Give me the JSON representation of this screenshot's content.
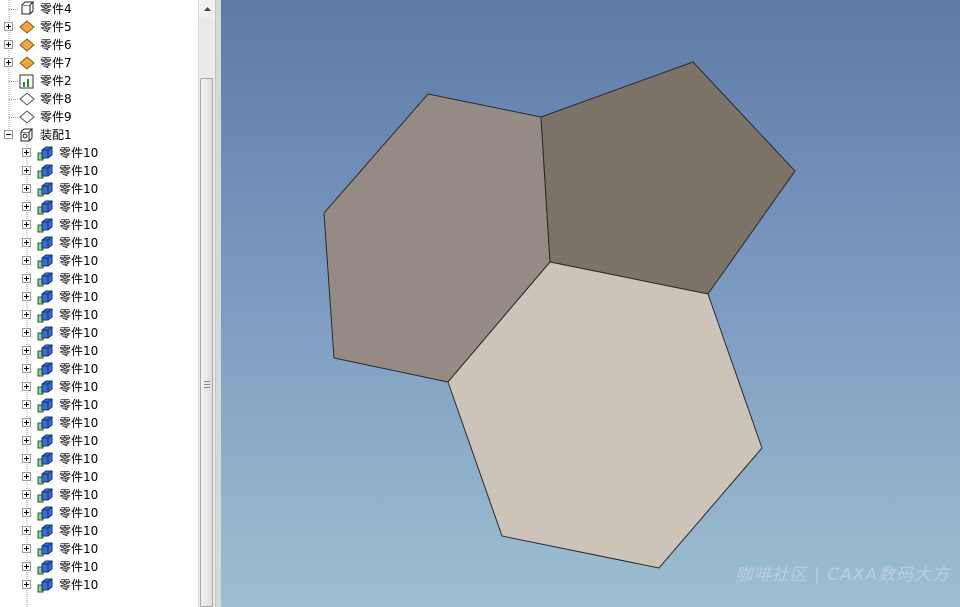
{
  "tree": {
    "top_items": [
      {
        "label": "零件4",
        "icon": "part-outline-icon",
        "expandable": false
      },
      {
        "label": "零件5",
        "icon": "part-diamond-icon",
        "expandable": true
      },
      {
        "label": "零件6",
        "icon": "part-diamond-icon",
        "expandable": true
      },
      {
        "label": "零件7",
        "icon": "part-diamond-icon",
        "expandable": true
      },
      {
        "label": "零件2",
        "icon": "part-chart-icon",
        "expandable": false
      },
      {
        "label": "零件8",
        "icon": "part-diamond-outline-icon",
        "expandable": false
      },
      {
        "label": "零件9",
        "icon": "part-diamond-outline-icon",
        "expandable": false
      },
      {
        "label": "装配1",
        "icon": "assembly-icon",
        "expandable": true,
        "expanded": true
      }
    ],
    "child_label": "零件10",
    "child_icon": "component-cube-icon",
    "children": [
      "零件10",
      "零件10",
      "零件10",
      "零件10",
      "零件10",
      "零件10",
      "零件10",
      "零件10",
      "零件10",
      "零件10",
      "零件10",
      "零件10",
      "零件10",
      "零件10",
      "零件10",
      "零件10",
      "零件10",
      "零件10",
      "零件10",
      "零件10",
      "零件10",
      "零件10",
      "零件10",
      "零件10",
      "零件10"
    ]
  },
  "viewport": {
    "background_top": "#5d7aa8",
    "background_bottom": "#9dbfd0",
    "shapes": [
      {
        "name": "hexagon-left",
        "color": "#958b84"
      },
      {
        "name": "pentagon-right",
        "color": "#7b7268"
      },
      {
        "name": "hexagon-bottom",
        "color": "#cdc4b9"
      }
    ]
  },
  "watermark": "咖啡社区 | CAXA数码大方"
}
